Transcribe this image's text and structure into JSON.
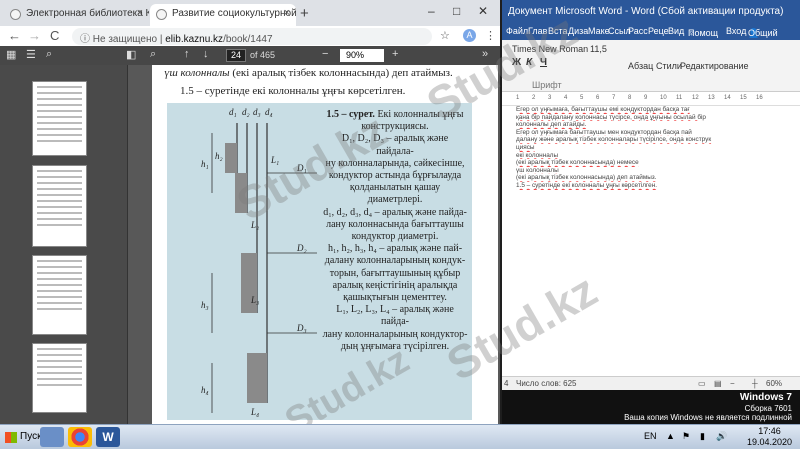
{
  "chrome": {
    "tabs": [
      {
        "label": "Электронная библиотека КазНУ",
        "close": "×"
      },
      {
        "label": "Развитие социокультурной коми",
        "close": "×"
      }
    ],
    "new_tab": "+",
    "window_controls": {
      "minimize": "–",
      "maximize": "□",
      "close": "✕"
    },
    "nav": {
      "back": "←",
      "forward": "→",
      "reload": "C"
    },
    "address": {
      "security": "Не защищено",
      "host": "elib.kaznu.kz",
      "path": "/book/1447"
    },
    "avatar_letter": "A",
    "menu": "⋮"
  },
  "pdf_toolbar": {
    "page_current": "24",
    "page_total": "of 465",
    "zoom": "90%",
    "zoom_minus": "−",
    "zoom_plus": "+"
  },
  "pdf_page": {
    "line1_italic": "үш колонналы",
    "line1_rest": " (екі аралық тізбек колоннасында) деп атаймыз.",
    "line2": "1.5 – суретінде екі колонналы ұңғы көрсетілген.",
    "caption_title": "1.5 – сурет.",
    "caption_lines": [
      "Екі колонналы ұңғы",
      "конструкциясы.",
      "D₁, D₂, D₃ – аралық және пайдала-",
      "ну колонналарында, сәйкесінше,",
      "кондуктор астында бұрғылауда",
      "қолданылатын қашау диаметрлері.",
      "d₁, d₂, d₃, d₄ – аралық және пайда-",
      "лану колоннасында бағыттаушы",
      "кондуктор диаметрі.",
      "h₁, h₂, h₃, h₄ – аралық және пай-",
      "далану колонналарының кондук-",
      "торын, бағыттаушының құбыр",
      "аралық кеңістігінің аралықда",
      "қашықтығын цементтеу.",
      "L₁, L₂, L₃, L₄ – аралық және пайда-",
      "лану колонналарының кондуктор-",
      "дың ұңғымаға түсірілген."
    ],
    "figure_labels": [
      "d₁",
      "d₂",
      "d₃",
      "d₄",
      "D₁",
      "D₂",
      "D₃",
      "h₁",
      "h₂",
      "h₃",
      "h₄",
      "L₁",
      "L₂",
      "L₃",
      "L₄"
    ]
  },
  "word": {
    "title": "Документ Microsoft Word - Word (Сбой активации продукта)",
    "ribbon_tabs": [
      "Файл",
      "Глав",
      "Вста",
      "Диза",
      "Маке",
      "Ссыл",
      "Расс",
      "Реце",
      "Вид"
    ],
    "help": "Помощ",
    "sign_in": "Вход",
    "share": "Общий доступ",
    "font_name": "Times New Roman",
    "font_size": "11,5",
    "format_buttons": [
      "Ж",
      "К",
      "Ч"
    ],
    "groups": [
      "Абзац",
      "Стили",
      "Редактирование"
    ],
    "font_group": "Шрифт",
    "ruler": [
      "1",
      "2",
      "3",
      "4",
      "5",
      "6",
      "7",
      "8",
      "9",
      "10",
      "11",
      "12",
      "13",
      "14",
      "15",
      "16"
    ],
    "doc_lines": [
      "Егер ол уңғымаға, бағыттаушы емі кондуктордан басқа тағ",
      "қана бір пайдалану колоннасы түсірсе, онда ұңғыны осылай бір",
      "колонналы деп атайды.",
      "Егер ол уңғымаға бағыттаушы мен кондуктордан басқа пай",
      "далану және аралық тізбек колонналары түсірілсе, онда конструк",
      "циясы",
      "екі колонналы",
      "(екі аралық тізбек колоннасында) немесе",
      "үш колонналы",
      "(екі аралық тізбек колоннасында) деп атаймыз.",
      "1.5 – суретінде екі колонналы ұңғы көрсетілген."
    ],
    "status_words": "Число слов: 625",
    "status_zoom": "60%",
    "status_page": "4"
  },
  "desktop": {
    "os_name": "Windows 7",
    "build": "Сборка 7601",
    "notice": "Ваша копия Windows не является подлинной",
    "watermark": "Stud.kz"
  },
  "taskbar": {
    "start_label": "Пуск",
    "lang": "EN",
    "time": "17:46",
    "date": "19.04.2020"
  },
  "colors": {
    "word_blue": "#2b579a",
    "chrome_tabbar": "#dee1e6",
    "pdf_toolbar": "#474747",
    "figure_bg": "#c8dde4"
  }
}
